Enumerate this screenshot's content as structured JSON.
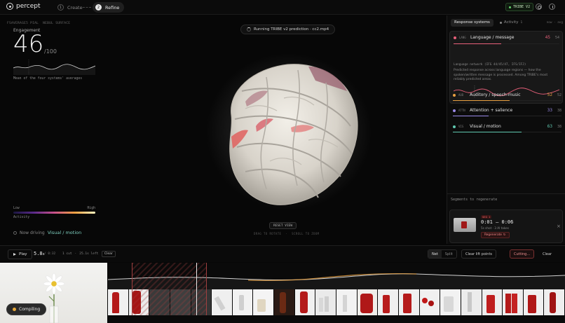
{
  "app": {
    "name": "percept"
  },
  "steps": [
    {
      "num": "1",
      "label": "Create"
    },
    {
      "num": "2",
      "label": "Refine"
    }
  ],
  "badge": {
    "label": "TRIBE V2"
  },
  "left": {
    "fsa": "FSAVERAGE5 PIAL",
    "surface": "NEBUL SURFACE",
    "engagement_label": "Engagement",
    "engagement_value": "46",
    "engagement_max": "/100",
    "mean_note": "Mean of the four systems' averages",
    "low": "Low",
    "high": "High",
    "activity": "Activity",
    "driving_prefix": "Now driving",
    "driving_value": "Visual / motion"
  },
  "center": {
    "running": "Running TRIBE v2 prediction · cc2.mp4",
    "reset": "RESET VIEW",
    "hint_drag": "DRAG TO ROTATE",
    "hint_scroll": "SCROLL TO ZOOM"
  },
  "right": {
    "tab_systems": "Response systems",
    "tab_activity": "Activity",
    "tab_activity_count": "1",
    "now_avg": "now · avg",
    "systems": [
      {
        "code": "LANG",
        "name": "Language / message",
        "now": "45",
        "avg": "54",
        "color": "#e8607a",
        "fill": 0.45
      },
      {
        "code": "AUD",
        "name": "Auditory / speech-music",
        "now": "52",
        "avg": "52",
        "color": "#e8a040",
        "fill": 0.52
      },
      {
        "code": "ATTN",
        "name": "Attention + salience",
        "now": "33",
        "avg": "38",
        "color": "#9a8ae8",
        "fill": 0.33
      },
      {
        "code": "VIS",
        "name": "Visual / motion",
        "now": "63",
        "avg": "38",
        "color": "#60c8b0",
        "fill": 0.63
      }
    ],
    "lang_network": "Language network (IFG 44/45/47, IFS/IFJ)",
    "lang_desc": "Predicted response across language regions — how the spoken/written message is processed. Among TRIBE's most reliably predicted areas.",
    "segments_title": "Segments to regenerate",
    "segment": {
      "chip": "SEG 1",
      "time": "0:01 – 0:06",
      "meta": "5s shot · 3 AI takes",
      "regen": "Regenerate"
    }
  },
  "timeline": {
    "play": "Play",
    "current": "5.8",
    "unit": "s",
    "total": "/ 0:32",
    "cut": "1 cut",
    "left": "25.1s left",
    "clear_small": "Clear",
    "toggle_on": "Net",
    "toggle_off": "Split",
    "clear_lift": "Clear lift points",
    "cutting": "Cutting…",
    "clear": "Clear"
  },
  "compiling": "Compiling"
}
